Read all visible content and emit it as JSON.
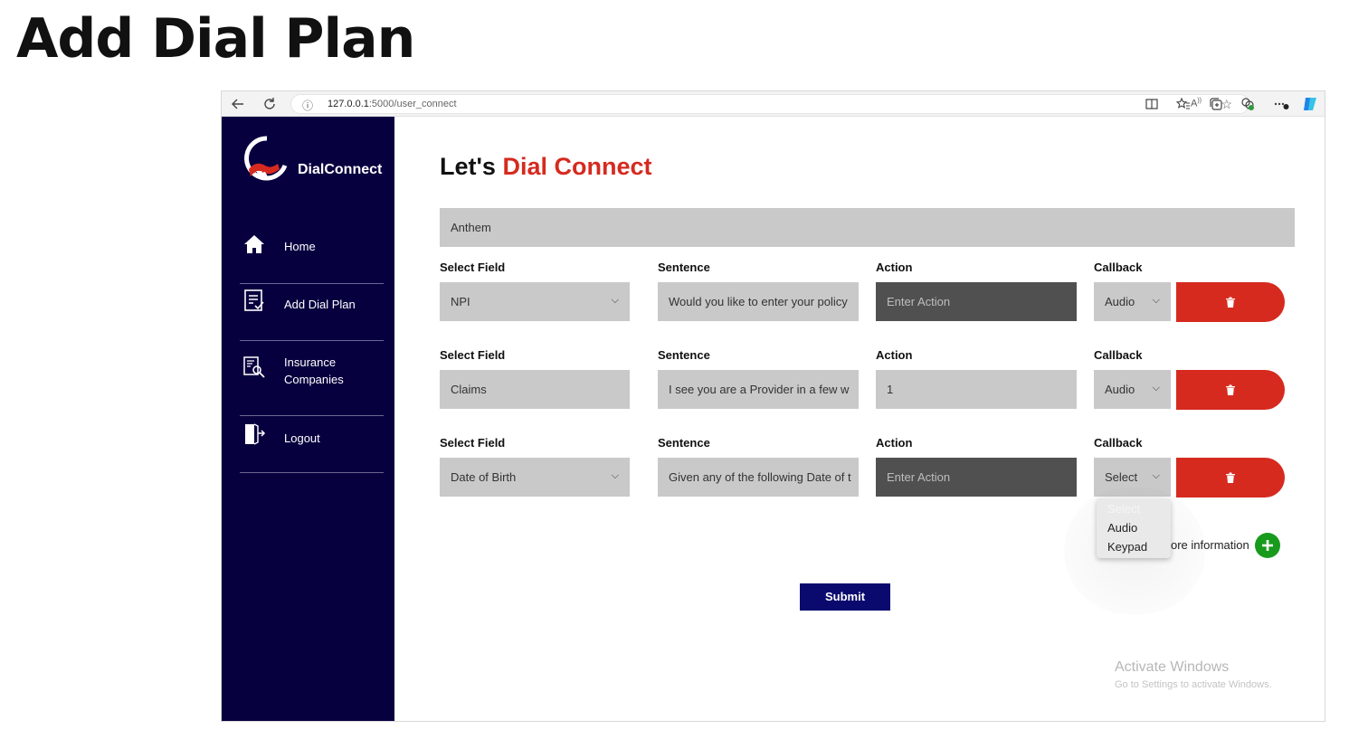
{
  "page_heading": "Add Dial Plan",
  "browser": {
    "url_host": "127.0.0.1",
    "url_path": ":5000/user_connect",
    "toolbar_icons": [
      "back-icon",
      "refresh-icon",
      "info-icon",
      "read-aloud-icon",
      "favorite-star-icon",
      "split-screen-icon",
      "favorites-icon",
      "collections-icon",
      "extensions-icon",
      "more-icon",
      "copilot-icon"
    ]
  },
  "sidebar": {
    "brand": "DialConnect",
    "items": [
      {
        "label": "Home",
        "icon": "home-icon"
      },
      {
        "label": "Add Dial Plan",
        "icon": "checklist-icon"
      },
      {
        "label": "Insurance\nCompanies",
        "icon": "search-document-icon"
      },
      {
        "label": "Logout",
        "icon": "logout-door-icon"
      }
    ]
  },
  "main": {
    "title_prefix": "Let's ",
    "title_accent": "Dial Connect",
    "company_value": "Anthem",
    "column_labels": {
      "select_field": "Select Field",
      "sentence": "Sentence",
      "action": "Action",
      "callback": "Callback"
    },
    "rows": [
      {
        "select_field": "NPI",
        "select_has_chevron": true,
        "sentence": "Would you like to enter your policy",
        "action": "Enter Action",
        "action_placeholder": true,
        "callback": "Audio"
      },
      {
        "select_field": "Claims",
        "select_has_chevron": false,
        "sentence": "I see you are a  Provider in a few w",
        "action": "1",
        "action_placeholder": false,
        "callback": "Audio"
      },
      {
        "select_field": "Date of Birth",
        "select_has_chevron": true,
        "sentence": "Given any of the following Date of t",
        "action": "Enter Action",
        "action_placeholder": true,
        "callback": "Select"
      }
    ],
    "callback_dropdown": {
      "options": [
        "Select",
        "Audio",
        "Keypad"
      ]
    },
    "more_info_label": "ore information",
    "submit_label": "Submit"
  },
  "watermark": {
    "title": "Activate Windows",
    "subtitle": "Go to Settings to activate Windows."
  },
  "colors": {
    "sidebar_bg": "#07003f",
    "accent_red": "#d62a1f",
    "submit_bg": "#0a0a6e",
    "add_green": "#189a1d",
    "field_gray": "#c9c9c9",
    "field_dark": "#505050"
  }
}
